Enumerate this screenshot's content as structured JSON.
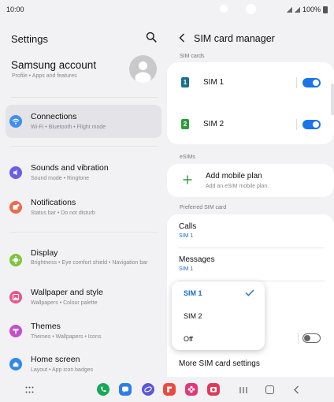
{
  "status_bar": {
    "time": "10:00",
    "battery": "100%"
  },
  "left": {
    "title": "Settings",
    "account": {
      "name": "Samsung account",
      "sub": "Profile • Apps and features"
    },
    "items": [
      {
        "label": "Connections",
        "sub": "Wi-Fi • Bluetooth • Flight mode",
        "icon": "wifi-icon",
        "color": "#3f8ef0"
      },
      {
        "label": "Sounds and vibration",
        "sub": "Sound mode • Ringtone",
        "icon": "sound-icon",
        "color": "#6a5ee8"
      },
      {
        "label": "Notifications",
        "sub": "Status bar • Do not disturb",
        "icon": "notification-icon",
        "color": "#ee6a4a"
      },
      {
        "label": "Display",
        "sub": "Brightness • Eye comfort shield • Navigation bar",
        "icon": "brightness-icon",
        "color": "#7cc53a"
      },
      {
        "label": "Wallpaper and style",
        "sub": "Wallpapers • Colour palette",
        "icon": "wallpaper-icon",
        "color": "#e8578a"
      },
      {
        "label": "Themes",
        "sub": "Themes • Wallpapers • Icons",
        "icon": "themes-icon",
        "color": "#c24fcf"
      },
      {
        "label": "Home screen",
        "sub": "Layout • App icon badges",
        "icon": "home-icon",
        "color": "#2f88f0"
      }
    ]
  },
  "right": {
    "title": "SIM card manager",
    "sections": {
      "sim_cards": "SIM cards",
      "esims": "eSIMs",
      "preferred": "Preferred SIM card"
    },
    "sims": [
      {
        "badge": "1",
        "label": "SIM 1",
        "color": "#1a6f8a",
        "enabled": true
      },
      {
        "badge": "2",
        "label": "SIM 2",
        "color": "#2e9a3e",
        "enabled": true
      }
    ],
    "add_plan": {
      "label": "Add mobile plan",
      "sub": "Add an eSIM mobile plan.",
      "icon_color": "#2e9a3e"
    },
    "calls": {
      "label": "Calls",
      "value": "SIM 1"
    },
    "messages": {
      "label": "Messages",
      "value": "SIM 1"
    },
    "more_settings": "More SIM card settings",
    "extra_toggle_enabled": false
  },
  "dropdown": {
    "options": [
      "SIM 1",
      "SIM 2",
      "Off"
    ],
    "selected": "SIM 1",
    "accent": "#1a6fc1"
  },
  "dock": [
    {
      "icon": "phone-icon",
      "color": "#17a85a"
    },
    {
      "icon": "messages-icon",
      "color": "#2f7de8"
    },
    {
      "icon": "internet-icon",
      "color": "#5c58d6"
    },
    {
      "icon": "flipboard-icon",
      "color": "#ec4a3e"
    },
    {
      "icon": "gallery-icon",
      "color": "#e0387a"
    },
    {
      "icon": "camera-icon",
      "color": "#e2385a"
    }
  ]
}
